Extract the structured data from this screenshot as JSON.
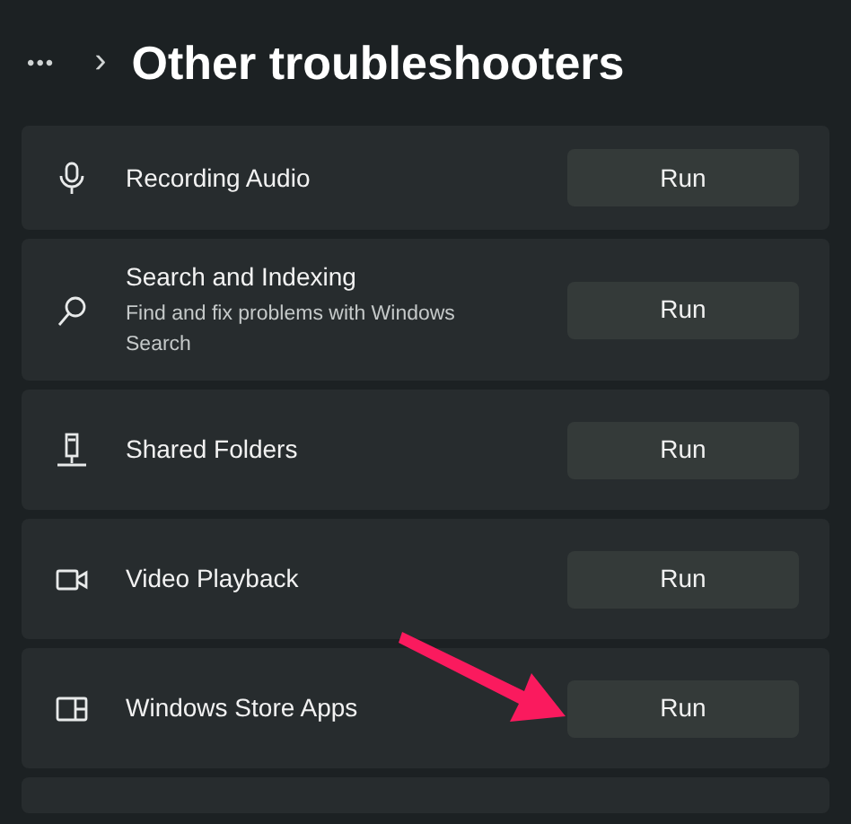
{
  "header": {
    "more": "•••",
    "separator": "›",
    "title": "Other troubleshooters"
  },
  "troubleshooters": [
    {
      "kind": "mic",
      "name": "Recording Audio",
      "button": "Run"
    },
    {
      "kind": "search",
      "name": "Search and Indexing",
      "description": "Find and fix problems with Windows Search",
      "button": "Run"
    },
    {
      "kind": "shared",
      "name": "Shared Folders",
      "button": "Run"
    },
    {
      "kind": "video",
      "name": "Video Playback",
      "button": "Run"
    },
    {
      "kind": "store",
      "name": "Windows Store Apps",
      "button": "Run"
    },
    {
      "kind": "cut"
    }
  ]
}
